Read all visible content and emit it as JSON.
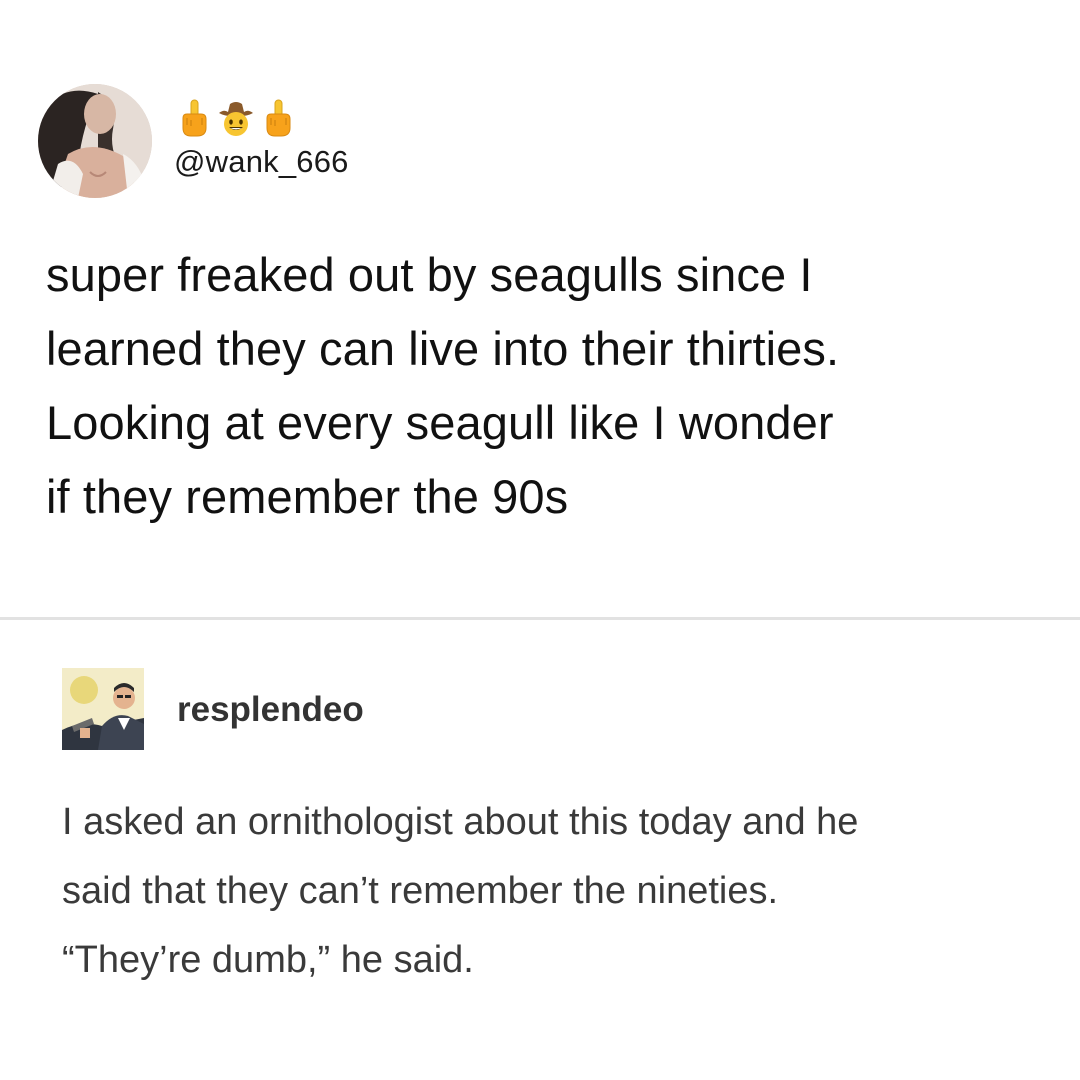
{
  "tweet": {
    "handle": "@wank_666",
    "emojis": [
      "middle-finger-icon",
      "cowboy-face-icon",
      "middle-finger-icon"
    ],
    "text": "super freaked out by seagulls since I\nlearned they can live into their thirties.\nLooking at every seagull like I wonder\nif they remember the 90s"
  },
  "reply": {
    "username": "resplendeo",
    "text": "I asked an ornithologist about this today and he\nsaid that they can’t remember the nineties.\n“They’re dumb,” he said."
  },
  "colors": {
    "background": "#ffffff",
    "divider": "#e2e2e2",
    "tweet_text": "#111111",
    "reply_text": "#3a3a3a",
    "emoji_yellow": "#f7c531"
  }
}
